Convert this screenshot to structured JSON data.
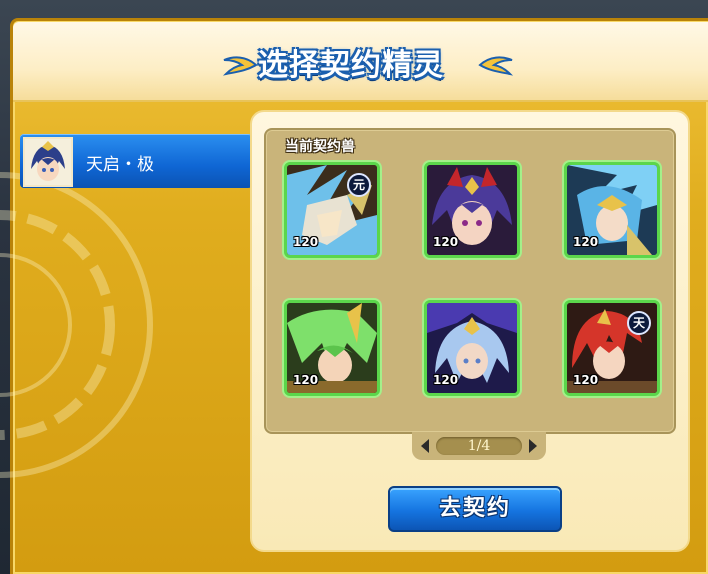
{
  "dialog": {
    "title": "选择契约精灵"
  },
  "selected_spirit": {
    "name": "天启・极",
    "icon": "spirit-portrait-icon"
  },
  "current_section": {
    "label": "当前契约兽"
  },
  "cards": [
    {
      "level": "120",
      "badge": "元",
      "icon": "white-armored-warrior-portrait"
    },
    {
      "level": "120",
      "badge": "",
      "icon": "purple-horned-warrior-portrait"
    },
    {
      "level": "120",
      "badge": "",
      "icon": "blue-winged-warrior-portrait"
    },
    {
      "level": "120",
      "badge": "",
      "icon": "green-haired-warrior-portrait"
    },
    {
      "level": "120",
      "badge": "",
      "icon": "blue-haired-warrior-portrait"
    },
    {
      "level": "120",
      "badge": "天",
      "icon": "red-haired-warrior-portrait"
    }
  ],
  "pager": {
    "text": "1/4"
  },
  "actions": {
    "go_contract_label": "去契约"
  },
  "colors": {
    "frame_gold": "#e0ad1e",
    "tab_blue": "#0f66d4",
    "card_border_green": "#5bd64b",
    "button_blue": "#1574e0"
  }
}
